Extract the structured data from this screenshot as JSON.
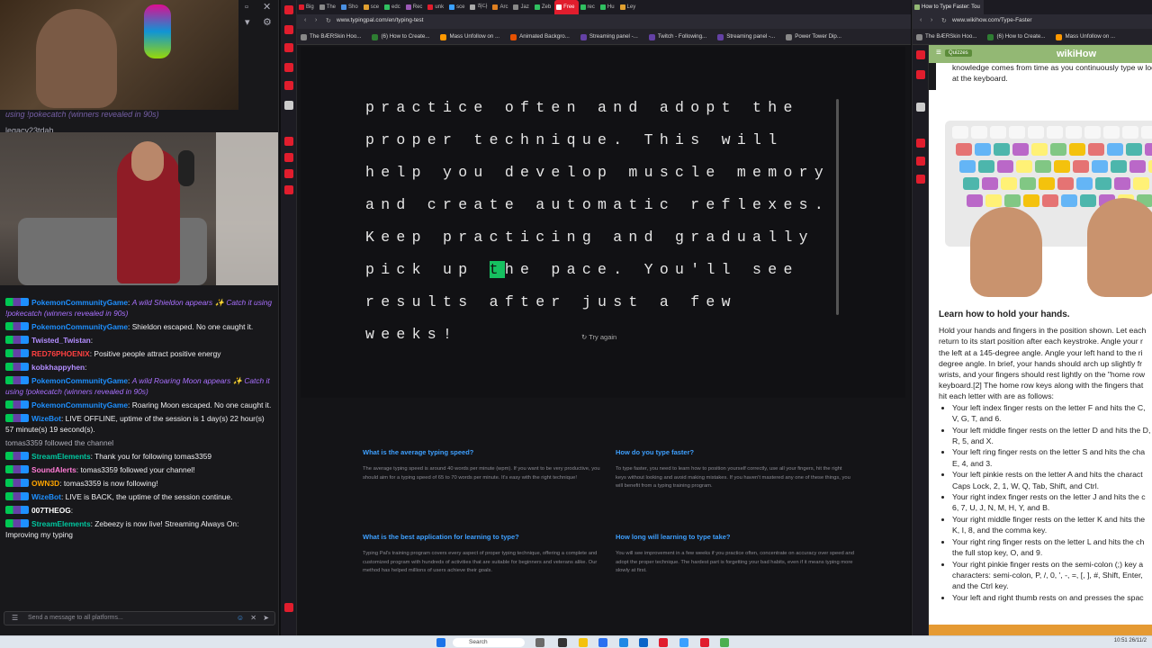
{
  "stream": {
    "catch_line": "using !pokecatch (winners revealed in 90s)",
    "legacy_user": "legacy23tdah",
    "chat": [
      {
        "user": "PokemonCommunityGame",
        "color": "#1e90ff",
        "text": "A wild Shieldon appears ✨ Catch it using !pokecatch (winners revealed in 90s)",
        "italic": true
      },
      {
        "user": "PokemonCommunityGame",
        "color": "#1e90ff",
        "text": "Shieldon escaped. No one caught it.",
        "italic": false
      },
      {
        "user": "Twisted_Twistan",
        "color": "#b28dff",
        "text": "",
        "italic": false
      },
      {
        "user": "RED76PHOENIX",
        "color": "#ff4040",
        "text": "Positive people attract positive energy",
        "italic": false
      },
      {
        "user": "kobkhappyhen",
        "color": "#b28dff",
        "text": "",
        "italic": false
      },
      {
        "user": "PokemonCommunityGame",
        "color": "#1e90ff",
        "text": "A wild Roaring Moon appears ✨ Catch it using !pokecatch (winners revealed in 90s)",
        "italic": true
      },
      {
        "user": "PokemonCommunityGame",
        "color": "#1e90ff",
        "text": "Roaring Moon escaped. No one caught it.",
        "italic": false
      },
      {
        "user": "WizeBot",
        "color": "#1e90ff",
        "text": "LIVE OFFLINE, uptime of the session is 1 day(s) 22 hour(s) 57 minute(s) 19 second(s).",
        "italic": false
      },
      {
        "user": "",
        "color": "#adadb8",
        "text": "tomas3359 followed the channel",
        "italic": false,
        "system": true
      },
      {
        "user": "StreamElements",
        "color": "#00c8a0",
        "text": "Thank you for following tomas3359",
        "italic": false
      },
      {
        "user": "SoundAlerts",
        "color": "#ff7bd5",
        "text": "tomas3359 followed your channel!",
        "italic": false
      },
      {
        "user": "OWN3D",
        "color": "#ffa500",
        "text": "tomas3359 is now following!",
        "italic": false
      },
      {
        "user": "WizeBot",
        "color": "#1e90ff",
        "text": "LIVE is BACK, the uptime of the session continue.",
        "italic": false
      },
      {
        "user": "007THEOG",
        "color": "#ffffff",
        "text": "",
        "italic": false
      },
      {
        "user": "StreamElements",
        "color": "#00c8a0",
        "text": "Zebeezy is now live! Streaming Always On: Improving my typing",
        "italic": false
      }
    ],
    "chat_placeholder": "Send a message to all platforms..."
  },
  "mid_browser": {
    "tabs": [
      "Big",
      "The",
      "Sho",
      "sce",
      "edc",
      "Rec",
      "unk",
      "sce",
      "하다",
      "Arc",
      "Jaz",
      "Zeb",
      "Free",
      "rec",
      "Hu",
      "Ley"
    ],
    "active_tab": "Free",
    "url": "www.typingpal.com/en/typing-test",
    "bookmarks": [
      "The BÆRSkin Hoo...",
      "(6) How to Create...",
      "Mass Unfollow on ...",
      "Animated Backgro...",
      "Streaming panel -...",
      "Twitch - Following...",
      "Streaming panel -...",
      "Power Tower Dip..."
    ]
  },
  "typing": {
    "before": "practice often and adopt the proper technique. This will help you develop muscle memory and create automatic reflexes. Keep practicing and gradually pick up ",
    "cursor": "t",
    "after": "he pace. You'll see results after just a few weeks!",
    "try_again": "Try again"
  },
  "faq": [
    {
      "q": "What is the average typing speed?",
      "a": "The average typing speed is around 40 words per minute (wpm). If you want to be very productive, you should aim for a typing speed of 65 to 70 words per minute. It's easy with the right technique!"
    },
    {
      "q": "How do you type faster?",
      "a": "To type faster, you need to learn how to position yourself correctly, use all your fingers, hit the right keys without looking and avoid making mistakes. If you haven't mastered any one of these things, you will benefit from a typing training program."
    },
    {
      "q": "What is the best application for learning to type?",
      "a": "Typing Pal's training program covers every aspect of proper typing technique, offering a complete and customized program with hundreds of activities that are suitable for beginners and veterans alike. Our method has helped millions of users achieve their goals."
    },
    {
      "q": "How long will learning to type take?",
      "a": "You will see improvement in a few weeks if you practice often, concentrate on accuracy over speed and adopt the proper technique. The hardest part is forgetting your bad habits, even if it means typing more slowly at first."
    }
  ],
  "right_browser": {
    "tab": "How to Type Faster: Tou",
    "url": "www.wikihow.com/Type-Faster",
    "bookmarks": [
      "The BÆRSkin Hoo...",
      "(6) How to Create...",
      "Mass Unfollow on ..."
    ],
    "quiz_label": "Quizzes",
    "logo": "wikiHow",
    "intro": "knowledge comes from time as you continuously type w looking at the keyboard.",
    "section_title": "Learn how to hold your hands.",
    "paragraph": "Hold your hands and fingers in the position shown. Let each return to its start position after each keystroke. Angle your r the left at a 145-degree angle. Angle your left hand to the ri degree angle. In brief, your hands should arch up slightly fr wrists, and your fingers should rest lightly on the \"home row keyboard.[2] The home row keys along with the fingers that hit each letter with are as follows:",
    "bullets": [
      "Your left index finger rests on the letter F and hits the C, V, G, T, and 6.",
      "Your left middle finger rests on the letter D and hits the D, R, 5, and X.",
      "Your left ring finger rests on the letter S and hits the cha E, 4, and 3.",
      "Your left pinkie rests on the letter A and hits the charact Caps Lock, 2, 1, W, Q, Tab, Shift, and Ctrl.",
      "Your right index finger rests on the letter J and hits the c 6, 7, U, J, N, M, H, Y, and B.",
      "Your right middle finger rests on the letter K and hits the K, I, 8, and the comma key.",
      "Your right ring finger rests on the letter L and hits the ch the full stop key, O, and 9.",
      "Your right pinkie finger rests on the semi-colon (;) key a characters: semi-colon, P, /, 0, ', -, =, [, ], #, Shift, Enter, and the Ctrl key.",
      "Your left and right thumb rests on and presses the spac"
    ]
  },
  "taskbar": {
    "search": "Search",
    "time": "10:51",
    "date": "26/11/2"
  }
}
